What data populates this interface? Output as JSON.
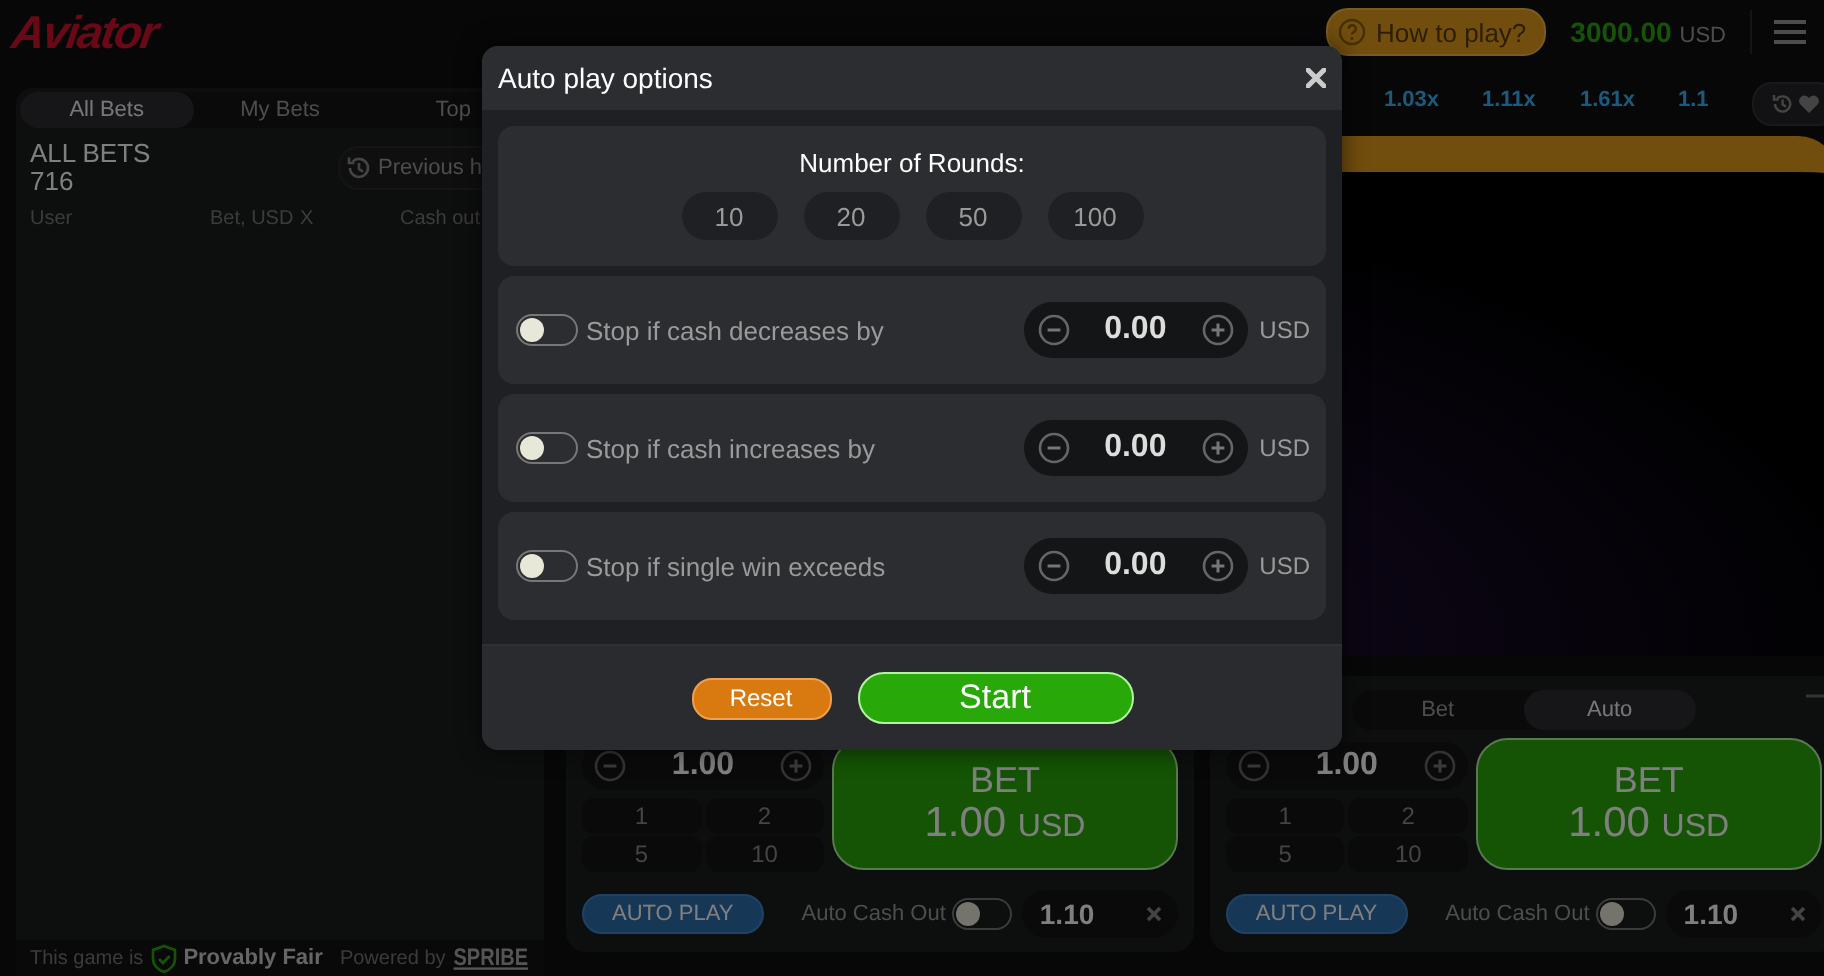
{
  "header": {
    "logo": "Aviator",
    "help_button": "How to play?",
    "balance": "3000.00",
    "currency": "USD"
  },
  "bets_panel": {
    "tabs": [
      {
        "label": "All Bets",
        "selected": true
      },
      {
        "label": "My Bets",
        "selected": false
      },
      {
        "label": "Top",
        "selected": false
      }
    ],
    "title": "ALL BETS",
    "count": "716",
    "history_button": "Previous h",
    "columns": [
      "User",
      "Bet, USD",
      "X",
      "Cash out"
    ],
    "footer": {
      "fair_prefix": "This game is",
      "fair_label": "Provably Fair",
      "powered_prefix": "Powered by",
      "powered_brand": "SPRIBE"
    }
  },
  "game": {
    "multipliers": [
      "1.03x",
      "1.11x",
      "1.61x",
      "1.1"
    ]
  },
  "bet_panels": [
    {
      "amount": "1.00",
      "quick_amounts": [
        "1",
        "2",
        "5",
        "10"
      ],
      "bet_label": "BET",
      "bet_amount": "1.00",
      "bet_currency": "USD",
      "auto_play": "AUTO PLAY",
      "auto_cash_out": "Auto Cash Out",
      "cash_out_on": false,
      "cash_out_value": "1.10"
    },
    {
      "tabs": [
        {
          "label": "Bet",
          "selected": false
        },
        {
          "label": "Auto",
          "selected": true
        }
      ],
      "amount": "1.00",
      "quick_amounts": [
        "1",
        "2",
        "5",
        "10"
      ],
      "bet_label": "BET",
      "bet_amount": "1.00",
      "bet_currency": "USD",
      "auto_play": "AUTO PLAY",
      "auto_cash_out": "Auto Cash Out",
      "cash_out_on": false,
      "cash_out_value": "1.10"
    }
  ],
  "modal": {
    "title": "Auto play options",
    "rounds_label": "Number of Rounds:",
    "rounds": [
      {
        "label": "10",
        "selected": false
      },
      {
        "label": "20",
        "selected": false
      },
      {
        "label": "50",
        "selected": false
      },
      {
        "label": "100",
        "selected": false
      }
    ],
    "conditions": [
      {
        "label": "Stop if cash decreases by",
        "on": false,
        "value": "0.00",
        "currency": "USD"
      },
      {
        "label": "Stop if cash increases by",
        "on": false,
        "value": "0.00",
        "currency": "USD"
      },
      {
        "label": "Stop if single win exceeds",
        "on": false,
        "value": "0.00",
        "currency": "USD"
      }
    ],
    "reset_button": "Reset",
    "start_button": "Start"
  }
}
